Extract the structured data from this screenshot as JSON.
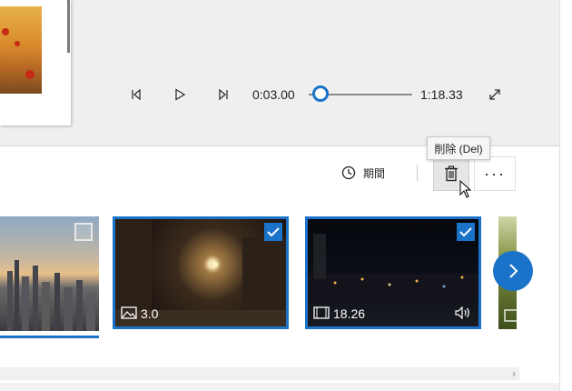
{
  "player": {
    "current_time": "0:03.00",
    "total_time": "1:18.33",
    "progress_fraction": 0.038
  },
  "toolbar": {
    "duration_label": "期間",
    "delete_tooltip": "削除 (Del)",
    "more_label": "···"
  },
  "clips": [
    {
      "selected": false,
      "type": "image"
    },
    {
      "selected": true,
      "type": "image",
      "duration": "3.0"
    },
    {
      "selected": true,
      "type": "video",
      "duration": "18.26",
      "has_audio": true
    },
    {
      "selected": false,
      "type": "video"
    }
  ],
  "colors": {
    "accent": "#1a73c9"
  },
  "icons": {
    "prev_frame": "step-back-icon",
    "play": "play-icon",
    "next_frame": "step-forward-icon",
    "fullscreen": "expand-icon",
    "duration": "clock-icon",
    "delete": "trash-icon",
    "next": "chevron-right-icon"
  }
}
